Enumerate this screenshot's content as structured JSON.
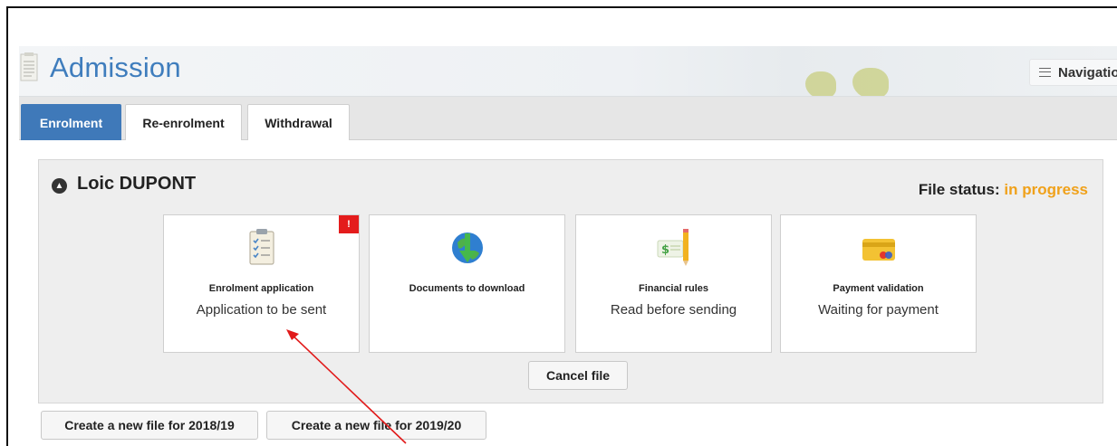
{
  "header": {
    "title": "Admission",
    "navigation_label": "Navigation"
  },
  "tabs": [
    {
      "label": "Enrolment",
      "active": true
    },
    {
      "label": "Re-enrolment",
      "active": false
    },
    {
      "label": "Withdrawal",
      "active": false
    }
  ],
  "file": {
    "name": "Loic DUPONT",
    "status_label": "File status:",
    "status_value": "in progress",
    "status_color": "#f0a11a"
  },
  "cards": [
    {
      "title": "Enrolment application",
      "subtitle": "Application to be sent",
      "icon": "checklist-icon",
      "badge": "!"
    },
    {
      "title": "Documents to download",
      "subtitle": "",
      "icon": "globe-download-icon"
    },
    {
      "title": "Financial rules",
      "subtitle": "Read before sending",
      "icon": "money-pencil-icon"
    },
    {
      "title": "Payment validation",
      "subtitle": "Waiting for payment",
      "icon": "credit-card-icon"
    }
  ],
  "actions": {
    "cancel_label": "Cancel file",
    "create_2018_label": "Create a new file for 2018/19",
    "create_2019_label": "Create a new file for 2019/20"
  },
  "colors": {
    "accent": "#3f79b9",
    "title": "#3f7dbd",
    "badge": "#e41c1c",
    "annotation_arrow": "#e11a1a"
  }
}
